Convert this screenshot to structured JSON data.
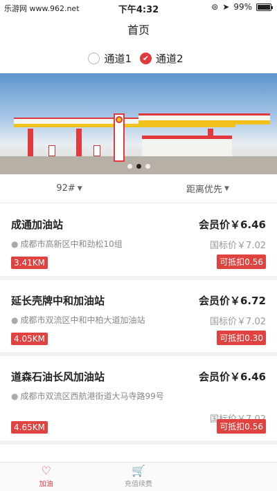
{
  "status_bar": {
    "carrier": "乐游网 www.962.net",
    "time": "下午4:32",
    "battery": "99%"
  },
  "header": {
    "title": "首页"
  },
  "channels": [
    {
      "label": "通道1",
      "selected": false
    },
    {
      "label": "通道2",
      "selected": true
    }
  ],
  "filters": [
    {
      "label": "92#"
    },
    {
      "label": "距离优先"
    }
  ],
  "stations": [
    {
      "name": "成通加油站",
      "member_price": "会员价￥6.46",
      "address": "成都市高新区中和劲松10组",
      "standard_price": "国标价￥7.02",
      "distance": "3.41KM",
      "discount": "可抵扣0.56"
    },
    {
      "name": "延长壳牌中和加油站",
      "member_price": "会员价￥6.72",
      "address": "成都市双流区中和中柏大道加油站",
      "standard_price": "国标价￥7.02",
      "distance": "4.05KM",
      "discount": "可抵扣0.30"
    },
    {
      "name": "道森石油长风加油站",
      "member_price": "会员价￥6.46",
      "address": "成都市双流区西航港街道大马寺路99号",
      "standard_price": "国标价￥7.02",
      "distance": "4.65KM",
      "discount": "可抵扣0.56"
    }
  ],
  "tabs": [
    {
      "label": "加油",
      "icon": "heart-home-icon",
      "active": true
    },
    {
      "label": "充值续费",
      "icon": "cart-icon",
      "active": false
    },
    {
      "label": "",
      "icon": "",
      "active": false
    }
  ],
  "colors": {
    "accent": "#e0393e"
  }
}
